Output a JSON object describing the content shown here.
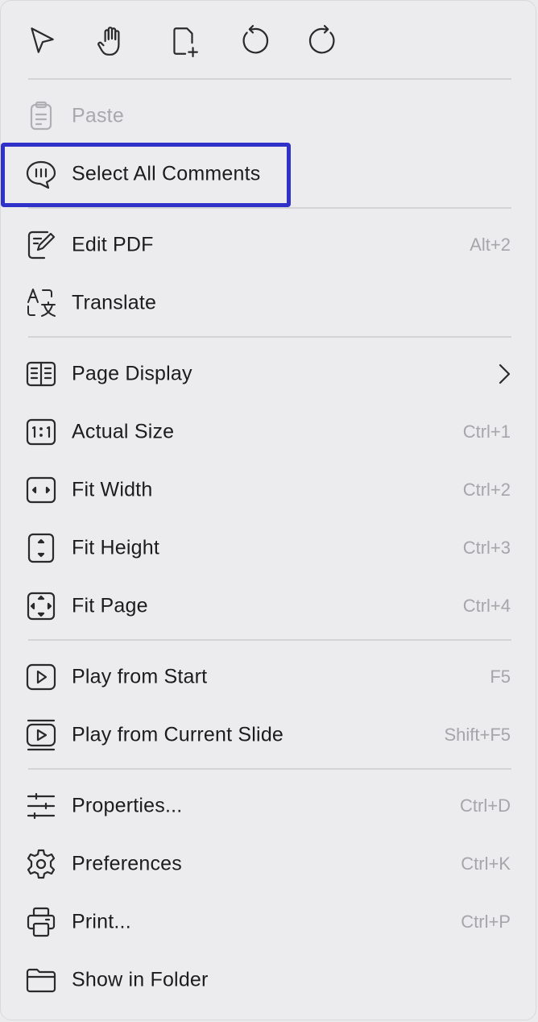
{
  "toolbar": {
    "tools": [
      {
        "name": "select-tool",
        "icon": "cursor-arrow-icon"
      },
      {
        "name": "hand-tool",
        "icon": "hand-icon"
      },
      {
        "name": "add-page-tool",
        "icon": "page-add-icon"
      },
      {
        "name": "undo-tool",
        "icon": "undo-icon"
      },
      {
        "name": "redo-tool",
        "icon": "redo-icon"
      }
    ]
  },
  "menu": {
    "paste": {
      "label": "Paste",
      "icon": "clipboard-icon",
      "enabled": false
    },
    "select_all_comments": {
      "label": "Select All Comments",
      "icon": "comment-bubble-icon",
      "highlighted": true
    },
    "edit_pdf": {
      "label": "Edit PDF",
      "shortcut": "Alt+2",
      "icon": "edit-pdf-icon"
    },
    "translate": {
      "label": "Translate",
      "icon": "translate-icon"
    },
    "page_display": {
      "label": "Page Display",
      "icon": "page-display-icon",
      "has_submenu": true
    },
    "actual_size": {
      "label": "Actual Size",
      "shortcut": "Ctrl+1",
      "icon": "actual-size-icon"
    },
    "fit_width": {
      "label": "Fit Width",
      "shortcut": "Ctrl+2",
      "icon": "fit-width-icon"
    },
    "fit_height": {
      "label": "Fit Height",
      "shortcut": "Ctrl+3",
      "icon": "fit-height-icon"
    },
    "fit_page": {
      "label": "Fit Page",
      "shortcut": "Ctrl+4",
      "icon": "fit-page-icon"
    },
    "play_from_start": {
      "label": "Play from Start",
      "shortcut": "F5",
      "icon": "play-icon"
    },
    "play_from_current": {
      "label": "Play from Current Slide",
      "shortcut": "Shift+F5",
      "icon": "play-current-icon"
    },
    "properties": {
      "label": "Properties...",
      "shortcut": "Ctrl+D",
      "icon": "sliders-icon"
    },
    "preferences": {
      "label": "Preferences",
      "shortcut": "Ctrl+K",
      "icon": "gear-icon"
    },
    "print": {
      "label": "Print...",
      "shortcut": "Ctrl+P",
      "icon": "printer-icon"
    },
    "show_in_folder": {
      "label": "Show in Folder",
      "icon": "folder-icon"
    }
  },
  "colors": {
    "highlight": "#2f31c9",
    "disabled_text": "#a9a8ac",
    "shortcut_text": "#a6a5a9"
  }
}
